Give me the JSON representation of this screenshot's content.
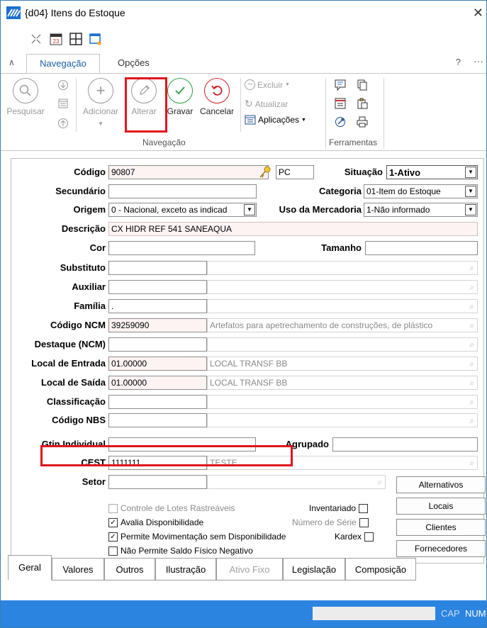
{
  "window": {
    "title": "{d04} Itens do Estoque",
    "close_glyph": "✕"
  },
  "ribbon_tabs": {
    "active": "Navegação",
    "other": "Opções",
    "help": "?",
    "more": "···"
  },
  "ribbon": {
    "pesquisar": "Pesquisar",
    "adicionar": "Adicionar",
    "alterar": "Alterar",
    "gravar": "Gravar",
    "cancelar": "Cancelar",
    "excluir": "Excluir",
    "atualizar": "Atualizar",
    "aplicacoes": "Aplicações",
    "group_navegacao": "Navegação",
    "group_ferramentas": "Ferramentas"
  },
  "form": {
    "labels": {
      "codigo": "Código",
      "situacao": "Situação",
      "secundario": "Secundário",
      "categoria": "Categoria",
      "origem": "Origem",
      "uso_mercadoria": "Uso da Mercadoria",
      "descricao": "Descrição",
      "cor": "Cor",
      "tamanho": "Tamanho",
      "substituto": "Substituto",
      "auxiliar": "Auxiliar",
      "familia": "Família",
      "codigo_ncm": "Código NCM",
      "destaque_ncm": "Destaque (NCM)",
      "local_entrada": "Local de Entrada",
      "local_saida": "Local de Saída",
      "classificacao": "Classificação",
      "codigo_nbs": "Código NBS",
      "gtin": "Gtin Individual",
      "agrupado": "Agrupado",
      "cest": "CEST",
      "setor": "Setor"
    },
    "values": {
      "codigo": "90807",
      "unidade": "PC",
      "situacao": "1-Ativo",
      "categoria": "01-Item do Estoque",
      "origem": "0 - Nacional, exceto as indicad",
      "uso_mercadoria": "1-Não informado",
      "descricao": "CX HIDR REF 541 SANEAQUA",
      "familia": ".",
      "codigo_ncm": "39259090",
      "ncm_desc": "Artefatos para apetrechamento de construções, de plástico",
      "local_entrada": "01.00000",
      "local_entrada_desc": "LOCAL TRANSF BB",
      "local_saida": "01.00000",
      "local_saida_desc": "LOCAL TRANSF BB",
      "cest": "1111111",
      "cest_desc": "TESTE"
    },
    "buttons": {
      "alternativos": "Alternativos",
      "locais": "Locais",
      "clientes": "Clientes",
      "fornecedores": "Fornecedores"
    },
    "checkboxes": {
      "controle_lotes": "Controle de Lotes Rastreáveis",
      "avalia": "Avalia Disponibilidade",
      "permite_mov": "Permite Movimentação sem Disponibilidade",
      "nao_permite": "Não Permite Saldo Físico Negativo",
      "inventariado": "Inventariado",
      "numero_serie": "Número de Série",
      "kardex": "Kardex"
    }
  },
  "bottom_tabs": [
    "Geral",
    "Valores",
    "Outros",
    "Ilustração",
    "Ativo Fixo",
    "Legislação",
    "Composição"
  ],
  "status": {
    "cap": "CAP",
    "num": "NUM"
  },
  "colors": {
    "accent": "#2b84e0",
    "highlight": "#e0151d",
    "tab_active": "#1b5fa7"
  }
}
